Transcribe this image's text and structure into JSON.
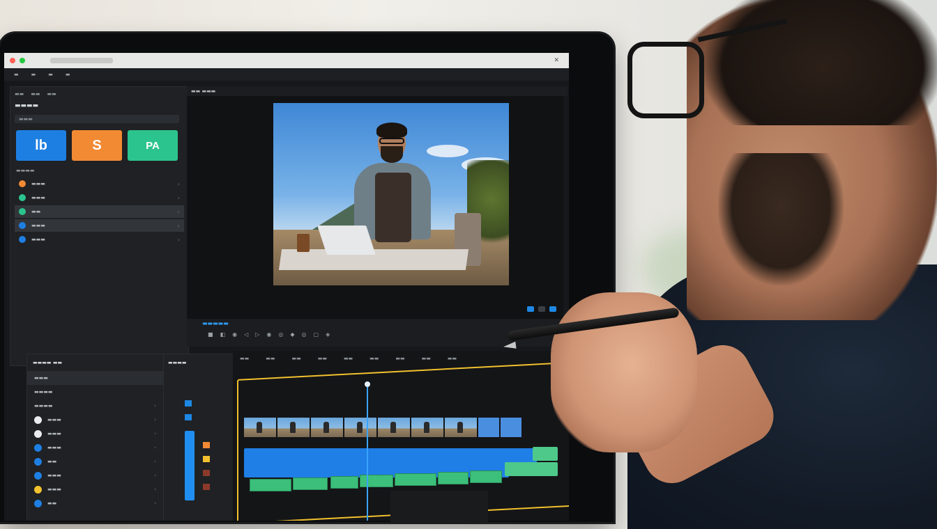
{
  "app": {
    "title_bar_icon": "window-controls",
    "menu": [
      "",
      "",
      "",
      ""
    ]
  },
  "left_panel": {
    "tiles": [
      {
        "label": "lb",
        "color": "#1e7fe3"
      },
      {
        "label": "S",
        "color": "#f28a33"
      },
      {
        "label": "PA",
        "color": "#2cc48e"
      }
    ],
    "items": [
      {
        "color": "#f28a33"
      },
      {
        "color": "#2cc48e"
      },
      {
        "color": "#2cc48e"
      },
      {
        "color": "#1e7fe3"
      },
      {
        "color": "#1e7fe3"
      }
    ]
  },
  "lower_left_items": [
    {
      "color": "#e8ecef"
    },
    {
      "color": "#e8ecef"
    },
    {
      "color": "#1e7fe3"
    },
    {
      "color": "#1e7fe3"
    },
    {
      "color": "#1e7fe3"
    },
    {
      "color": "#f2c12e"
    },
    {
      "color": "#1e7fe3"
    }
  ],
  "colors": {
    "accent_blue": "#1e88e5",
    "timeline_selection": "#f2c12e",
    "audio_green": "#4ec98a",
    "playhead": "#3aa4ff"
  }
}
